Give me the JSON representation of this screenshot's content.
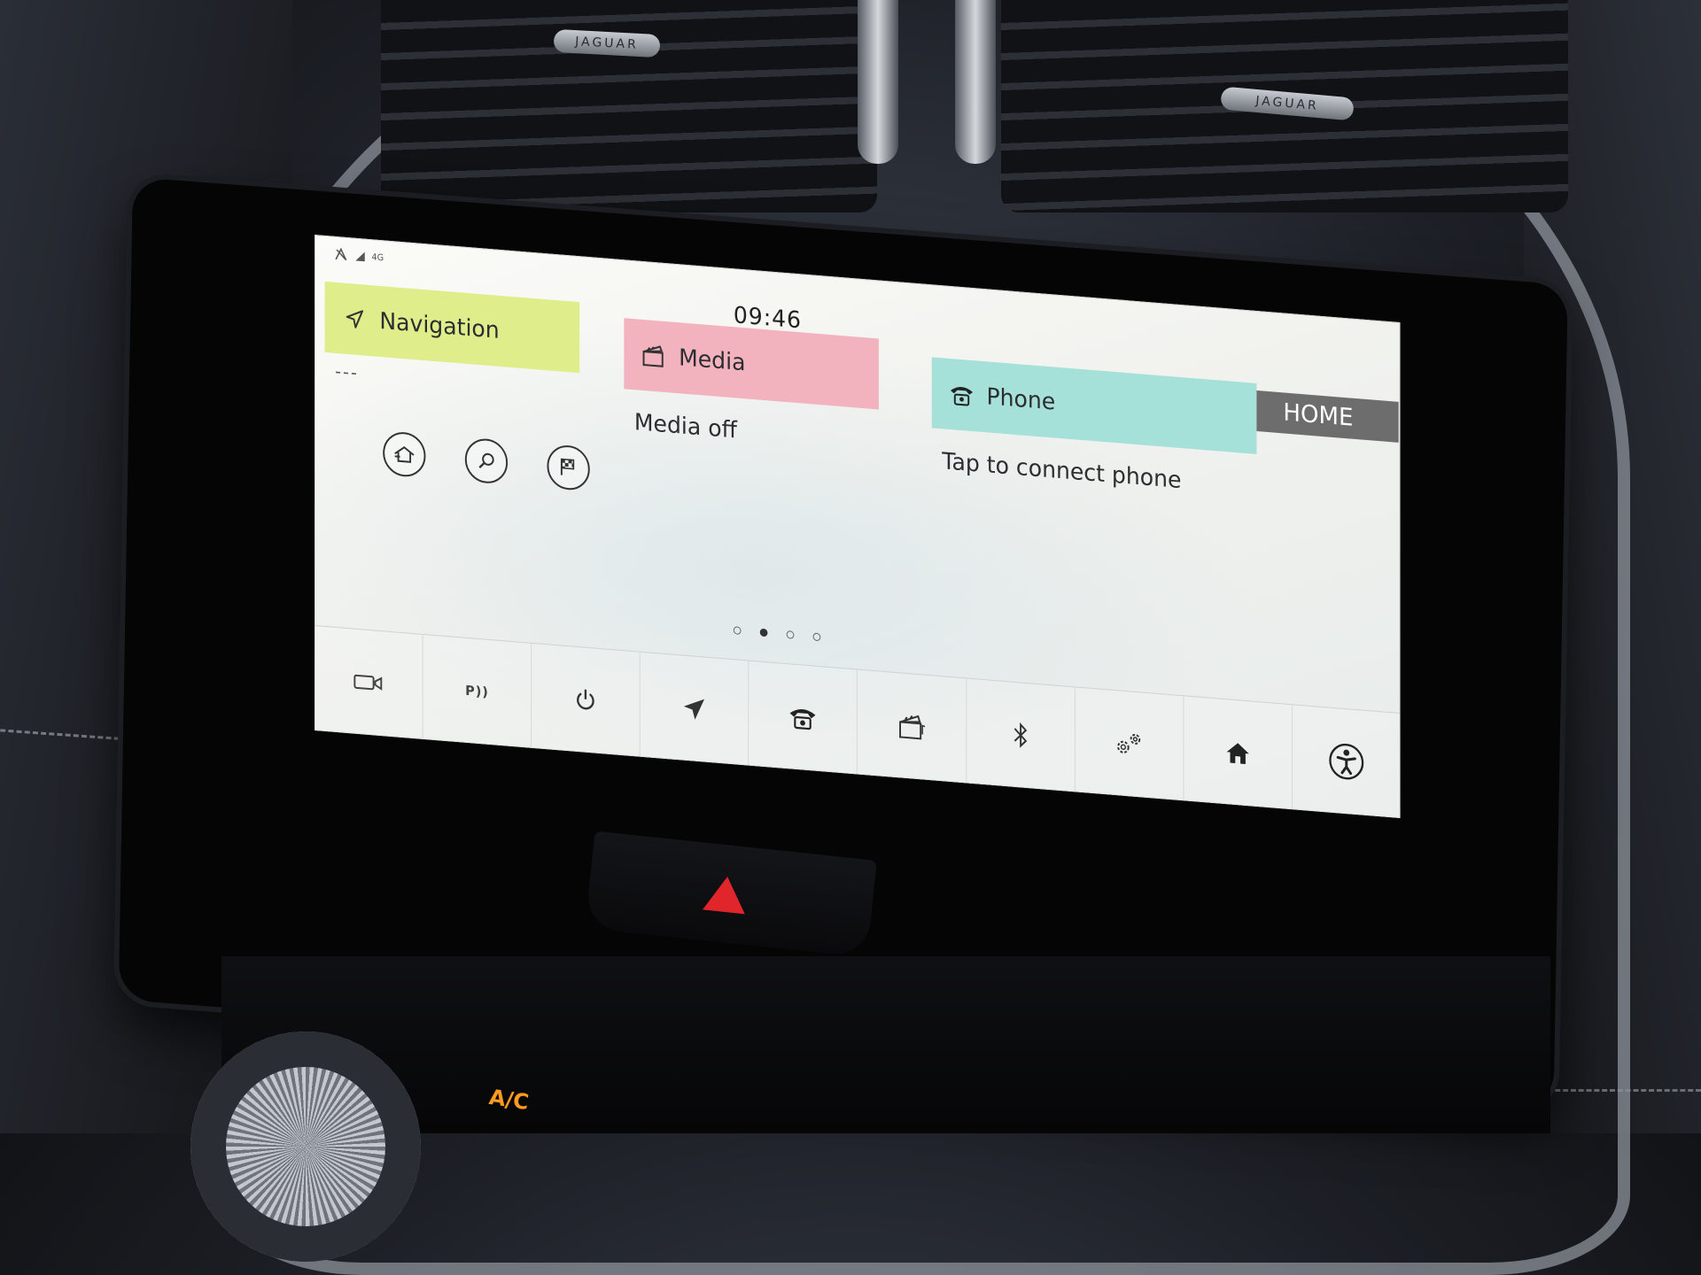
{
  "status_bar": {
    "signal_icon": "signal-bars-icon",
    "network_label": "4G"
  },
  "clock": "09:46",
  "home_tab": "HOME",
  "cards": {
    "navigation": {
      "title": "Navigation",
      "icon": "navigation-arrow-icon",
      "subtitle": "---",
      "color": "#dfee8a",
      "shortcuts": [
        "home-destination-icon",
        "search-icon",
        "destination-flag-icon"
      ]
    },
    "media": {
      "title": "Media",
      "icon": "clapperboard-icon",
      "status": "Media off",
      "color": "#f2b3bf"
    },
    "phone": {
      "title": "Phone",
      "icon": "telephone-icon",
      "status": "Tap to connect phone",
      "color": "#a5e1d9"
    }
  },
  "pagination": {
    "pages": 4,
    "active_index": 1
  },
  "bottom_bar": {
    "items": [
      "camera-icon",
      "parking-aid-icon",
      "power-icon",
      "navigation-arrow-icon",
      "telephone-icon",
      "clapperboard-icon",
      "bluetooth-icon",
      "settings-gears-icon",
      "home-icon",
      "accessibility-icon"
    ],
    "parking_aid_label": "P"
  },
  "vehicle": {
    "vent_badge": "JAGUAR",
    "ac_label": "A/C"
  }
}
